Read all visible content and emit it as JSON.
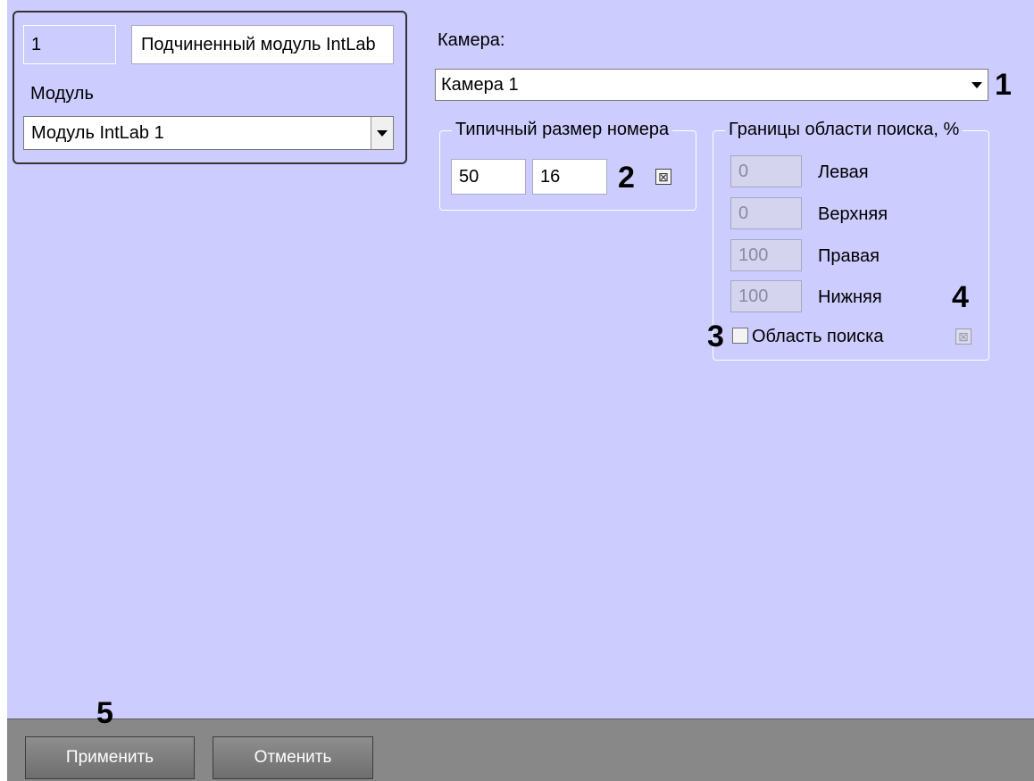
{
  "module_panel": {
    "id_value": "1",
    "name_value": "Подчиненный модуль IntLab",
    "module_label": "Модуль",
    "module_select_value": "Модуль IntLab 1"
  },
  "camera": {
    "label": "Камера:",
    "select_value": "Камера 1"
  },
  "plate_size": {
    "title": "Типичный размер номера",
    "width_value": "50",
    "height_value": "16",
    "reset_glyph": "⊠"
  },
  "search_area": {
    "title": "Границы области поиска, %",
    "left_value": "0",
    "left_label": "Левая",
    "top_value": "0",
    "top_label": "Верхняя",
    "right_value": "100",
    "right_label": "Правая",
    "bottom_value": "100",
    "bottom_label": "Нижняя",
    "enable_label": "Область поиска",
    "enable_checked": false,
    "reset_glyph": "⊠"
  },
  "callouts": {
    "c1": "1",
    "c2": "2",
    "c3": "3",
    "c4": "4",
    "c5": "5"
  },
  "buttons": {
    "apply_label": "Применить",
    "cancel_label": "Отменить"
  },
  "icons": {
    "dropdown": "dropdown-arrow-icon",
    "reset": "reset-x-icon"
  },
  "colors": {
    "panel_bg": "#ccccff",
    "bottom_bar": "#888888",
    "button": "#7a7a7a"
  }
}
